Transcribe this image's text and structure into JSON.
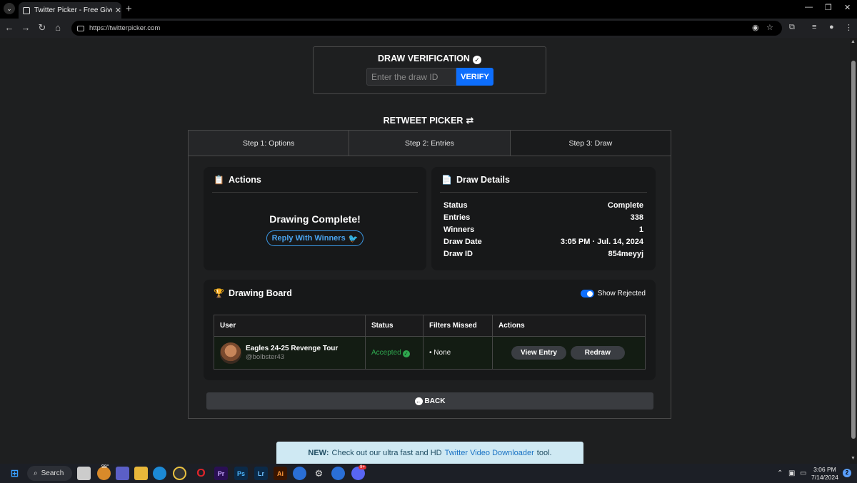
{
  "browser": {
    "tab_title": "Twitter Picker - Free Giveaway I",
    "tab_close": "✕",
    "new_tab": "+",
    "url": "https://twitterpicker.com"
  },
  "verification": {
    "title": "DRAW VERIFICATION",
    "input_placeholder": "Enter the draw ID",
    "verify_label": "VERIFY"
  },
  "picker": {
    "title": "RETWEET PICKER",
    "steps": [
      "Step 1: Options",
      "Step 2: Entries",
      "Step 3: Draw"
    ],
    "active_step": 3
  },
  "actions": {
    "title": "Actions",
    "status_text": "Drawing Complete!",
    "reply_label": "Reply With Winners"
  },
  "draw_details": {
    "title": "Draw Details",
    "rows": [
      {
        "label": "Status",
        "value": "Complete"
      },
      {
        "label": "Entries",
        "value": "338"
      },
      {
        "label": "Winners",
        "value": "1"
      },
      {
        "label": "Draw Date",
        "value": "3:05 PM · Jul. 14, 2024"
      },
      {
        "label": "Draw ID",
        "value": "854meyyj"
      }
    ]
  },
  "board": {
    "title": "Drawing Board",
    "toggle_label": "Show Rejected",
    "toggle_on": true,
    "columns": [
      "User",
      "Status",
      "Filters Missed",
      "Actions"
    ],
    "rows": [
      {
        "name": "Eagles 24-25 Revenge Tour",
        "handle": "@bolbster43",
        "status": "Accepted",
        "filters_missed": "• None",
        "view_label": "View Entry",
        "redraw_label": "Redraw"
      }
    ]
  },
  "back_label": "BACK",
  "banner": {
    "prefix": "NEW:",
    "text_before": "Check out our ultra fast and HD",
    "link": "Twitter Video Downloader",
    "text_after": "tool."
  },
  "taskbar": {
    "search_label": "Search",
    "weather": "98°",
    "time": "3:06 PM",
    "date": "7/14/2024",
    "notification_count": "2",
    "discord_badge": "9+"
  },
  "colors": {
    "accent": "#0d6efd",
    "accepted": "#2fa84f",
    "twitter": "#3b9ae8",
    "banner_bg": "#cfe9f3"
  }
}
